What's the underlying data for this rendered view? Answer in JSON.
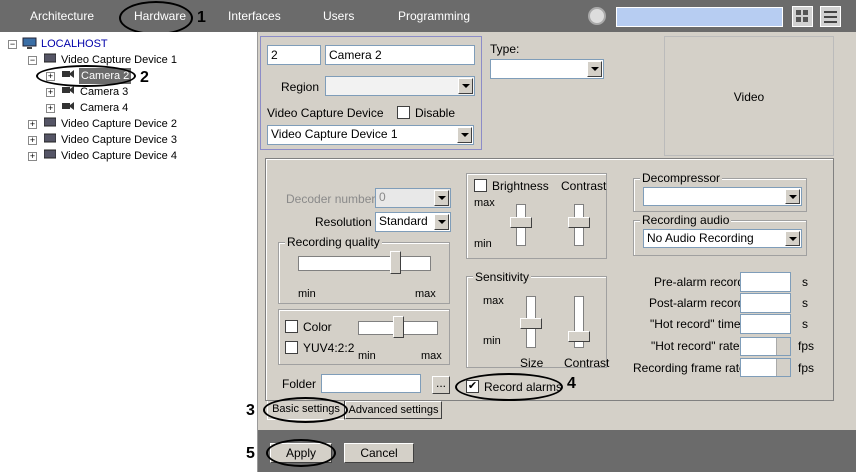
{
  "topbar": {
    "tabs": [
      "Architecture",
      "Hardware",
      "Interfaces",
      "Users",
      "Programming"
    ]
  },
  "callouts": [
    "1",
    "2",
    "3",
    "4",
    "5"
  ],
  "tree": {
    "root": "LOCALHOST",
    "items": [
      "Video Capture Device 1",
      "Camera 2",
      "Camera 3",
      "Camera 4",
      "Video Capture Device 2",
      "Video Capture Device 3",
      "Video Capture Device 4"
    ]
  },
  "header": {
    "id": "2",
    "name": "Camera 2",
    "region_label": "Region",
    "region_value": "",
    "type_label": "Type:",
    "type_value": "",
    "vcd_label": "Video Capture Device",
    "disable_label": "Disable",
    "vcd_value": "Video Capture Device 1",
    "video_label": "Video"
  },
  "settings": {
    "decoder_label": "Decoder number",
    "decoder_value": "0",
    "resolution_label": "Resolution",
    "resolution_value": "Standard",
    "rec_quality_label": "Recording quality",
    "min": "min",
    "max": "max",
    "color_label": "Color",
    "yuv_label": "YUV4:2:2",
    "brightness_label": "Brightness",
    "contrast_label": "Contrast",
    "sensitivity_label": "Sensitivity",
    "size_label": "Size",
    "decompressor_label": "Decompressor",
    "decompressor_value": "",
    "rec_audio_label": "Recording audio",
    "rec_audio_value": "No Audio Recording",
    "prealarm_label": "Pre-alarm record",
    "postalarm_label": "Post-alarm record",
    "hot_time_label": "\"Hot record\" time",
    "hot_rate_label": "\"Hot record\" rate",
    "rec_frame_label": "Recording frame rate",
    "unit_s": "s",
    "unit_fps": "fps",
    "folder_label": "Folder",
    "folder_value": "",
    "browse": "...",
    "record_alarms_label": "Record alarms",
    "record_alarms_checked": true,
    "tab_basic": "Basic settings",
    "tab_advanced": "Advanced settings"
  },
  "buttons": {
    "apply": "Apply",
    "cancel": "Cancel"
  }
}
